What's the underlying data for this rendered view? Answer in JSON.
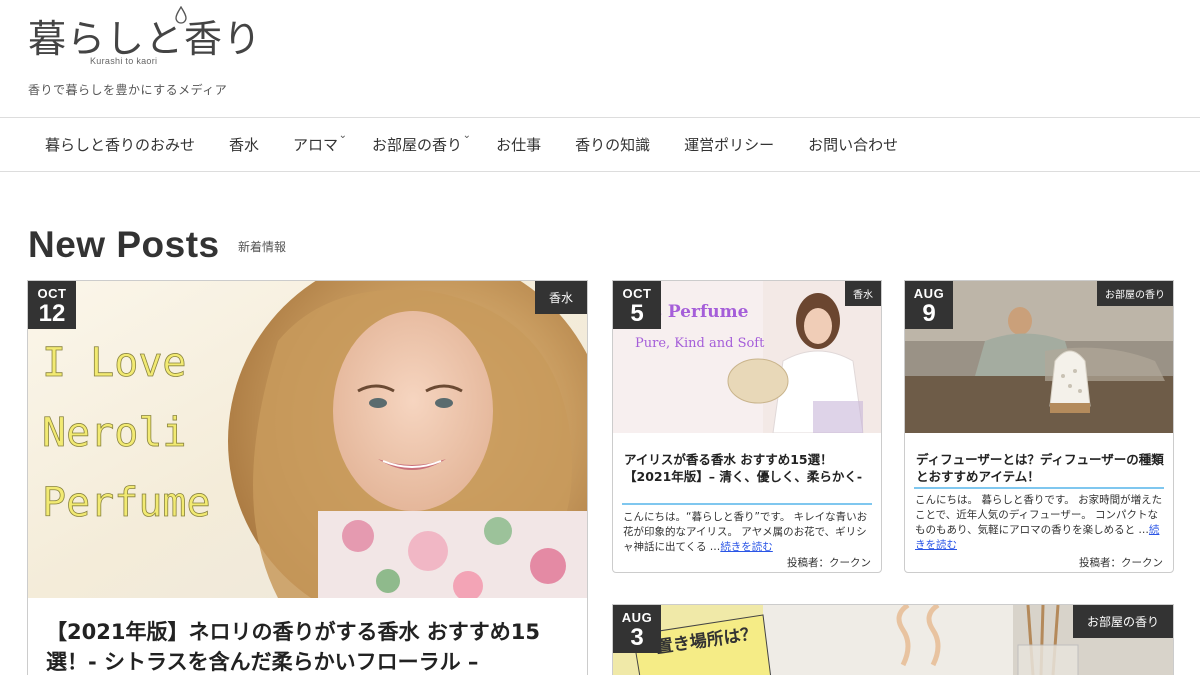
{
  "header": {
    "logo_text": "暮らしと香り",
    "logo_sub": "Kurashi to kaori",
    "tagline": "香りで暮らしを豊かにするメディア"
  },
  "nav": {
    "items": [
      {
        "label": "暮らしと香りのおみせ",
        "has_dropdown": false
      },
      {
        "label": "香水",
        "has_dropdown": false
      },
      {
        "label": "アロマ",
        "has_dropdown": true
      },
      {
        "label": "お部屋の香り",
        "has_dropdown": true
      },
      {
        "label": "お仕事",
        "has_dropdown": false
      },
      {
        "label": "香りの知識",
        "has_dropdown": false
      },
      {
        "label": "運営ポリシー",
        "has_dropdown": false
      },
      {
        "label": "お問い合わせ",
        "has_dropdown": false
      }
    ]
  },
  "section": {
    "title": "New Posts",
    "subtitle": "新着情報"
  },
  "posts": {
    "featured": {
      "month": "OCT",
      "day": "12",
      "category": "香水",
      "image_text": [
        "I Love",
        "Neroli",
        "Perfume"
      ],
      "title": "【2021年版】ネロリの香りがする香水 おすすめ15選！- シトラスを含んだ柔らかいフローラル –"
    },
    "post_a": {
      "month": "OCT",
      "day": "5",
      "category": "香水",
      "image_text": [
        "Iris Perfume",
        "Pure, Kind and Soft"
      ],
      "title": "アイリスが香る香水 おすすめ15選！【2021年版】– 清く、優しく、柔らかく-",
      "excerpt": "こんにちは。“暮らしと香り”です。 キレイな青いお花が印象的なアイリス。 アヤメ属のお花で、ギリシャ神話に出てくる …",
      "more": "続きを読む",
      "author": "投稿者：クークン"
    },
    "post_b": {
      "month": "AUG",
      "day": "9",
      "category": "お部屋の香り",
      "title": "ディフューザーとは？ディフューザーの種類とおすすめアイテム！",
      "excerpt": "こんにちは。 暮らしと香りです。 お家時間が増えたことで、近年人気のディフューザー。 コンパクトなものもあり、気軽にアロマの香りを楽しめると …",
      "more": "続きを読む",
      "author": "投稿者：クークン"
    },
    "post_c": {
      "month": "AUG",
      "day": "3",
      "category": "お部屋の香り",
      "image_text": [
        "置き場所は？"
      ]
    }
  },
  "colors": {
    "badge_bg": "#333333",
    "accent_rule": "#7fc7ef",
    "link": "#2a55e6"
  }
}
